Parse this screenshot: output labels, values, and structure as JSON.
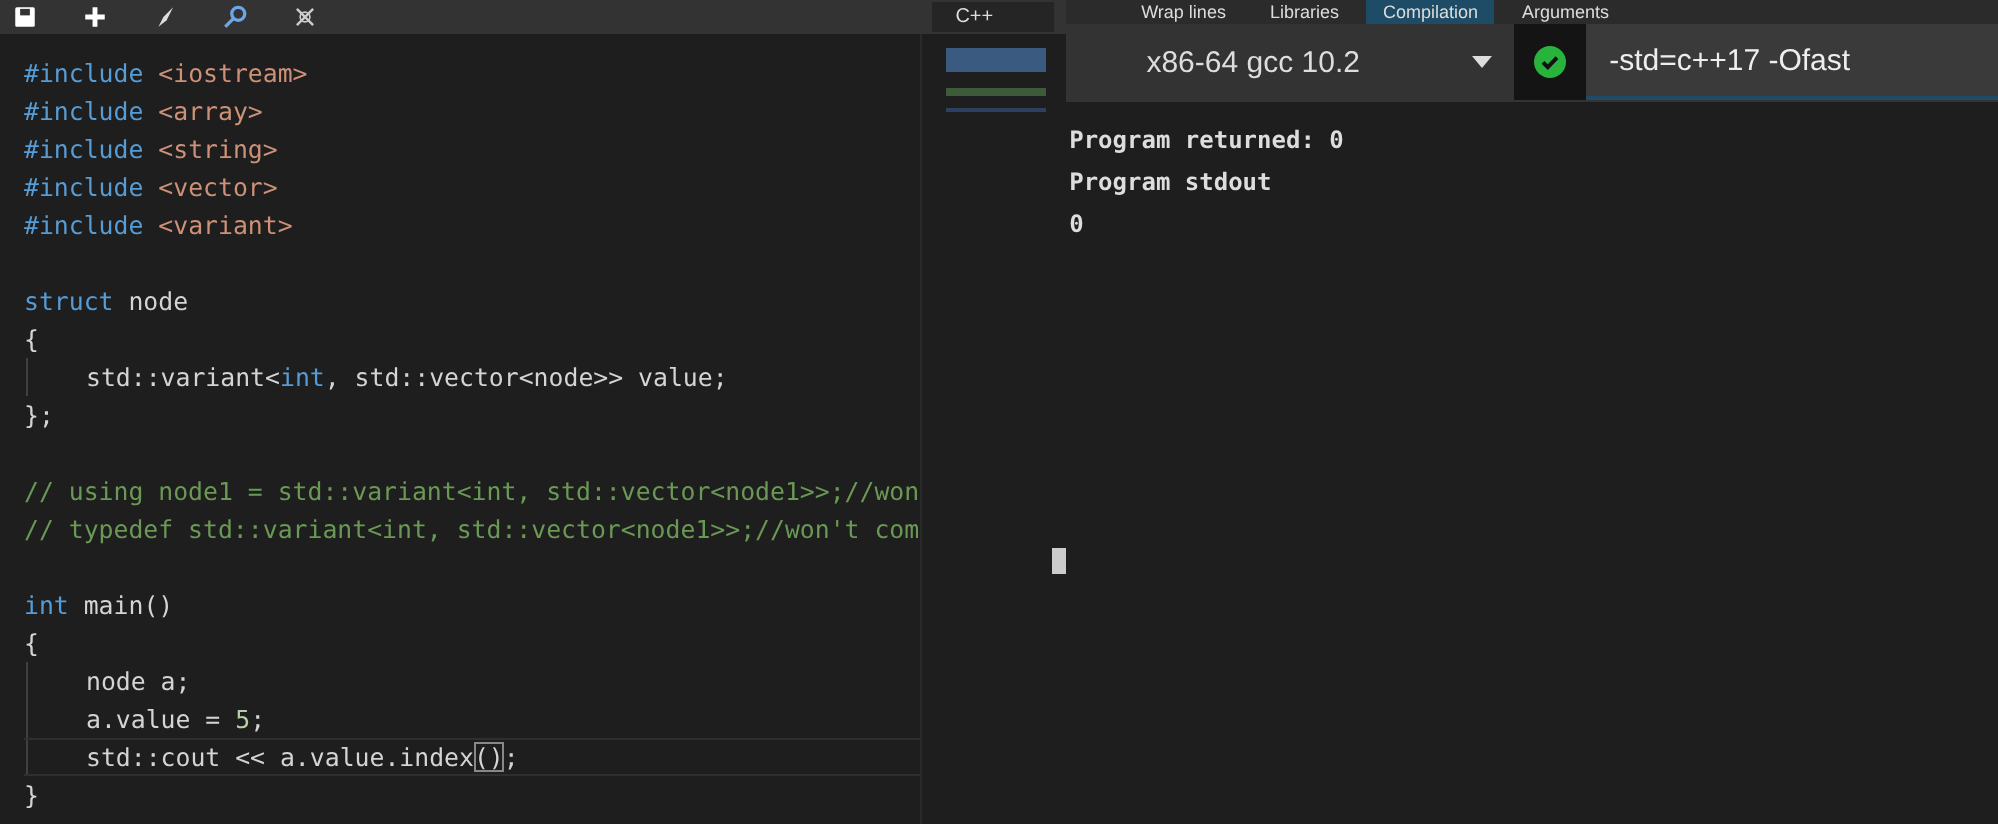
{
  "editor": {
    "toolbar": {
      "language": "C++"
    },
    "code_lines": [
      {
        "kind": "code",
        "indented": false,
        "current": false,
        "tokens": [
          {
            "kind": "keyword",
            "text": "#include"
          },
          {
            "kind": "string",
            "text": " <iostream>"
          }
        ]
      },
      {
        "kind": "code",
        "indented": false,
        "current": false,
        "tokens": [
          {
            "kind": "keyword",
            "text": "#include"
          },
          {
            "kind": "string",
            "text": " <array>"
          }
        ]
      },
      {
        "kind": "code",
        "indented": false,
        "current": false,
        "tokens": [
          {
            "kind": "keyword",
            "text": "#include"
          },
          {
            "kind": "string",
            "text": " <string>"
          }
        ]
      },
      {
        "kind": "code",
        "indented": false,
        "current": false,
        "tokens": [
          {
            "kind": "keyword",
            "text": "#include"
          },
          {
            "kind": "string",
            "text": " <vector>"
          }
        ]
      },
      {
        "kind": "code",
        "indented": false,
        "current": false,
        "tokens": [
          {
            "kind": "keyword",
            "text": "#include"
          },
          {
            "kind": "string",
            "text": " <variant>"
          }
        ]
      },
      {
        "kind": "blank"
      },
      {
        "kind": "code",
        "indented": false,
        "current": false,
        "tokens": [
          {
            "kind": "keyword",
            "text": "struct"
          },
          {
            "kind": "plain",
            "text": " node"
          }
        ]
      },
      {
        "kind": "code",
        "indented": false,
        "current": false,
        "tokens": [
          {
            "kind": "plain",
            "text": "{"
          }
        ]
      },
      {
        "kind": "code",
        "indented": true,
        "current": false,
        "tokens": [
          {
            "kind": "plain",
            "text": "std::variant<"
          },
          {
            "kind": "keyword",
            "text": "int"
          },
          {
            "kind": "plain",
            "text": ", std::vector<node>> value;"
          }
        ]
      },
      {
        "kind": "code",
        "indented": false,
        "current": false,
        "tokens": [
          {
            "kind": "plain",
            "text": "};"
          }
        ]
      },
      {
        "kind": "blank"
      },
      {
        "kind": "code",
        "indented": false,
        "current": false,
        "tokens": [
          {
            "kind": "comment",
            "text": "// using node1 = std::variant<int, std::vector<node1>>;//won"
          }
        ]
      },
      {
        "kind": "code",
        "indented": false,
        "current": false,
        "tokens": [
          {
            "kind": "comment",
            "text": "// typedef std::variant<int, std::vector<node1>>;//won't com"
          }
        ]
      },
      {
        "kind": "blank"
      },
      {
        "kind": "code",
        "indented": false,
        "current": false,
        "tokens": [
          {
            "kind": "keyword",
            "text": "int"
          },
          {
            "kind": "plain",
            "text": " main()"
          }
        ]
      },
      {
        "kind": "code",
        "indented": false,
        "current": false,
        "tokens": [
          {
            "kind": "plain",
            "text": "{"
          }
        ]
      },
      {
        "kind": "code",
        "indented": true,
        "current": false,
        "tokens": [
          {
            "kind": "plain",
            "text": "node a;"
          }
        ]
      },
      {
        "kind": "code",
        "indented": true,
        "current": false,
        "tokens": [
          {
            "kind": "plain",
            "text": "a.value = "
          },
          {
            "kind": "number",
            "text": "5"
          },
          {
            "kind": "plain",
            "text": ";"
          }
        ]
      },
      {
        "kind": "code",
        "indented": true,
        "current": true,
        "tokens": [
          {
            "kind": "plain",
            "text": "std::cout << a.value.index"
          },
          {
            "kind": "matched",
            "text": "()"
          },
          {
            "kind": "plain",
            "text": ";"
          }
        ]
      },
      {
        "kind": "code",
        "indented": false,
        "current": false,
        "tokens": [
          {
            "kind": "plain",
            "text": "}"
          }
        ]
      }
    ]
  },
  "compiler": {
    "tabs": [
      {
        "label": "Wrap lines",
        "selected": false
      },
      {
        "label": "Libraries",
        "selected": false
      },
      {
        "label": "Compilation",
        "selected": true
      },
      {
        "label": "Arguments",
        "selected": false
      }
    ],
    "compiler_select": "x86-64 gcc 10.2",
    "status_ok": true,
    "options": "-std=c++17 -Ofast",
    "output": [
      "Program returned: 0",
      "Program stdout",
      "0"
    ]
  }
}
